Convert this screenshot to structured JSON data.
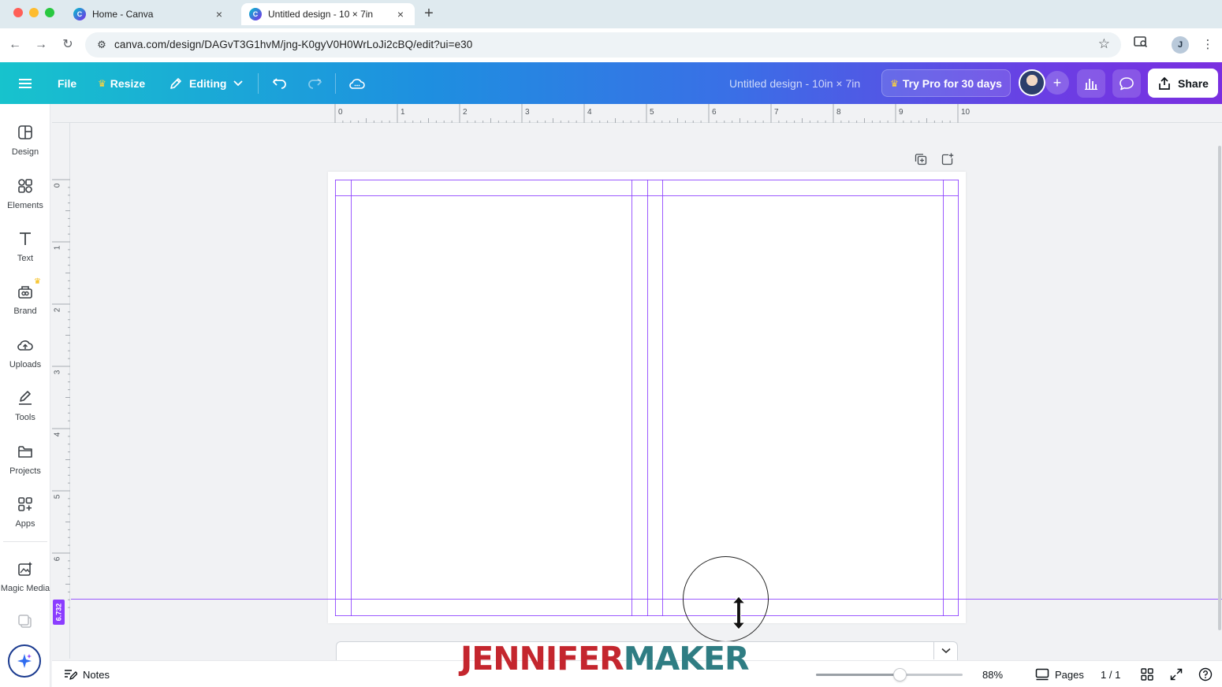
{
  "browser": {
    "tabs": [
      {
        "title": "Home - Canva",
        "close": "×"
      },
      {
        "title": "Untitled design - 10 × 7in",
        "close": "×"
      }
    ],
    "new_tab": "+",
    "url": "canva.com/design/DAGvT3G1hvM/jng-K0gyV0H0WrLoJi2cBQ/edit?ui=e30"
  },
  "header": {
    "file_label": "File",
    "resize_label": "Resize",
    "editing_label": "Editing",
    "doc_title": "Untitled design - 10in × 7in",
    "try_pro_label": "Try Pro for 30 days",
    "share_label": "Share",
    "brand_gradient": [
      "#17c3cd",
      "#3a6fe6",
      "#7a2fe0"
    ]
  },
  "sidebar": {
    "items": [
      {
        "label": "Design",
        "icon": "design-icon"
      },
      {
        "label": "Elements",
        "icon": "elements-icon"
      },
      {
        "label": "Text",
        "icon": "text-icon"
      },
      {
        "label": "Brand",
        "icon": "brand-icon"
      },
      {
        "label": "Uploads",
        "icon": "uploads-icon"
      },
      {
        "label": "Tools",
        "icon": "tools-icon"
      },
      {
        "label": "Projects",
        "icon": "projects-icon"
      },
      {
        "label": "Apps",
        "icon": "apps-icon"
      },
      {
        "label": "Magic Media",
        "icon": "magic-media-icon"
      }
    ]
  },
  "rulers": {
    "top_ticks": [
      "0",
      "1",
      "2",
      "3",
      "4",
      "5",
      "6",
      "7",
      "8",
      "9",
      "10"
    ],
    "left_ticks": [
      "0",
      "1",
      "2",
      "3",
      "4",
      "5",
      "6"
    ],
    "guide_marker": "6.732"
  },
  "bottom": {
    "notes_label": "Notes",
    "zoom_value": 0.57,
    "zoom_label": "88%",
    "pages_label": "Pages",
    "page_count": "1 / 1"
  },
  "watermark": {
    "part1": "JENNIFER",
    "part2": "MAKER"
  },
  "colors": {
    "guide": "#8b3dff",
    "watermark_red": "#c4262e",
    "watermark_teal": "#2f7d83"
  }
}
